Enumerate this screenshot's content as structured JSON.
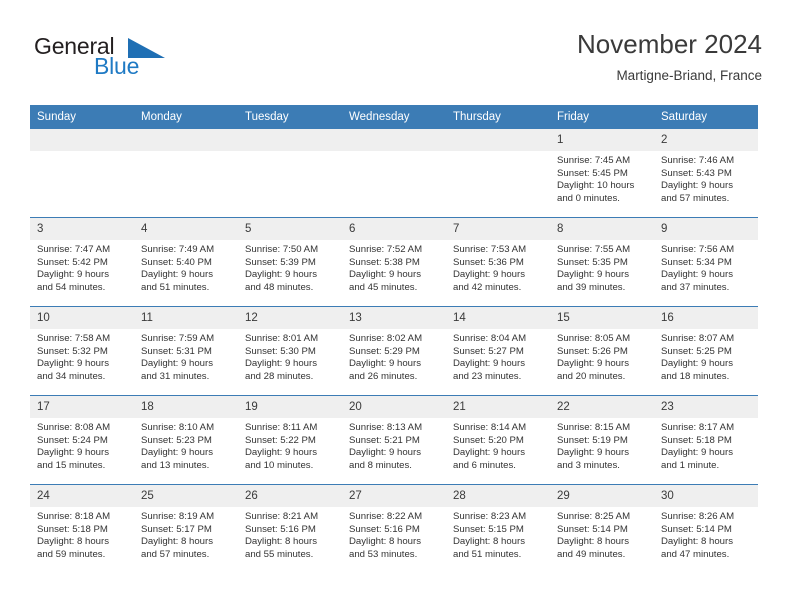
{
  "brand": {
    "name_part1": "General",
    "name_part2": "Blue",
    "logo_icon": "blue-triangle-flag-icon",
    "accent_color": "#1f7ac4"
  },
  "header": {
    "title": "November 2024",
    "location": "Martigne-Briand, France"
  },
  "theme": {
    "header_blue": "#3c7cb5",
    "daynum_band": "#efefef",
    "text": "#333333"
  },
  "calendar": {
    "weekday_headers": [
      "Sunday",
      "Monday",
      "Tuesday",
      "Wednesday",
      "Thursday",
      "Friday",
      "Saturday"
    ],
    "weeks": [
      [
        {
          "day": "",
          "blank": true,
          "info": ""
        },
        {
          "day": "",
          "blank": true,
          "info": ""
        },
        {
          "day": "",
          "blank": true,
          "info": ""
        },
        {
          "day": "",
          "blank": true,
          "info": ""
        },
        {
          "day": "",
          "blank": true,
          "info": ""
        },
        {
          "day": "1",
          "blank": false,
          "info": "Sunrise: 7:45 AM\nSunset: 5:45 PM\nDaylight: 10 hours\nand 0 minutes."
        },
        {
          "day": "2",
          "blank": false,
          "info": "Sunrise: 7:46 AM\nSunset: 5:43 PM\nDaylight: 9 hours\nand 57 minutes."
        }
      ],
      [
        {
          "day": "3",
          "blank": false,
          "info": "Sunrise: 7:47 AM\nSunset: 5:42 PM\nDaylight: 9 hours\nand 54 minutes."
        },
        {
          "day": "4",
          "blank": false,
          "info": "Sunrise: 7:49 AM\nSunset: 5:40 PM\nDaylight: 9 hours\nand 51 minutes."
        },
        {
          "day": "5",
          "blank": false,
          "info": "Sunrise: 7:50 AM\nSunset: 5:39 PM\nDaylight: 9 hours\nand 48 minutes."
        },
        {
          "day": "6",
          "blank": false,
          "info": "Sunrise: 7:52 AM\nSunset: 5:38 PM\nDaylight: 9 hours\nand 45 minutes."
        },
        {
          "day": "7",
          "blank": false,
          "info": "Sunrise: 7:53 AM\nSunset: 5:36 PM\nDaylight: 9 hours\nand 42 minutes."
        },
        {
          "day": "8",
          "blank": false,
          "info": "Sunrise: 7:55 AM\nSunset: 5:35 PM\nDaylight: 9 hours\nand 39 minutes."
        },
        {
          "day": "9",
          "blank": false,
          "info": "Sunrise: 7:56 AM\nSunset: 5:34 PM\nDaylight: 9 hours\nand 37 minutes."
        }
      ],
      [
        {
          "day": "10",
          "blank": false,
          "info": "Sunrise: 7:58 AM\nSunset: 5:32 PM\nDaylight: 9 hours\nand 34 minutes."
        },
        {
          "day": "11",
          "blank": false,
          "info": "Sunrise: 7:59 AM\nSunset: 5:31 PM\nDaylight: 9 hours\nand 31 minutes."
        },
        {
          "day": "12",
          "blank": false,
          "info": "Sunrise: 8:01 AM\nSunset: 5:30 PM\nDaylight: 9 hours\nand 28 minutes."
        },
        {
          "day": "13",
          "blank": false,
          "info": "Sunrise: 8:02 AM\nSunset: 5:29 PM\nDaylight: 9 hours\nand 26 minutes."
        },
        {
          "day": "14",
          "blank": false,
          "info": "Sunrise: 8:04 AM\nSunset: 5:27 PM\nDaylight: 9 hours\nand 23 minutes."
        },
        {
          "day": "15",
          "blank": false,
          "info": "Sunrise: 8:05 AM\nSunset: 5:26 PM\nDaylight: 9 hours\nand 20 minutes."
        },
        {
          "day": "16",
          "blank": false,
          "info": "Sunrise: 8:07 AM\nSunset: 5:25 PM\nDaylight: 9 hours\nand 18 minutes."
        }
      ],
      [
        {
          "day": "17",
          "blank": false,
          "info": "Sunrise: 8:08 AM\nSunset: 5:24 PM\nDaylight: 9 hours\nand 15 minutes."
        },
        {
          "day": "18",
          "blank": false,
          "info": "Sunrise: 8:10 AM\nSunset: 5:23 PM\nDaylight: 9 hours\nand 13 minutes."
        },
        {
          "day": "19",
          "blank": false,
          "info": "Sunrise: 8:11 AM\nSunset: 5:22 PM\nDaylight: 9 hours\nand 10 minutes."
        },
        {
          "day": "20",
          "blank": false,
          "info": "Sunrise: 8:13 AM\nSunset: 5:21 PM\nDaylight: 9 hours\nand 8 minutes."
        },
        {
          "day": "21",
          "blank": false,
          "info": "Sunrise: 8:14 AM\nSunset: 5:20 PM\nDaylight: 9 hours\nand 6 minutes."
        },
        {
          "day": "22",
          "blank": false,
          "info": "Sunrise: 8:15 AM\nSunset: 5:19 PM\nDaylight: 9 hours\nand 3 minutes."
        },
        {
          "day": "23",
          "blank": false,
          "info": "Sunrise: 8:17 AM\nSunset: 5:18 PM\nDaylight: 9 hours\nand 1 minute."
        }
      ],
      [
        {
          "day": "24",
          "blank": false,
          "info": "Sunrise: 8:18 AM\nSunset: 5:18 PM\nDaylight: 8 hours\nand 59 minutes."
        },
        {
          "day": "25",
          "blank": false,
          "info": "Sunrise: 8:19 AM\nSunset: 5:17 PM\nDaylight: 8 hours\nand 57 minutes."
        },
        {
          "day": "26",
          "blank": false,
          "info": "Sunrise: 8:21 AM\nSunset: 5:16 PM\nDaylight: 8 hours\nand 55 minutes."
        },
        {
          "day": "27",
          "blank": false,
          "info": "Sunrise: 8:22 AM\nSunset: 5:16 PM\nDaylight: 8 hours\nand 53 minutes."
        },
        {
          "day": "28",
          "blank": false,
          "info": "Sunrise: 8:23 AM\nSunset: 5:15 PM\nDaylight: 8 hours\nand 51 minutes."
        },
        {
          "day": "29",
          "blank": false,
          "info": "Sunrise: 8:25 AM\nSunset: 5:14 PM\nDaylight: 8 hours\nand 49 minutes."
        },
        {
          "day": "30",
          "blank": false,
          "info": "Sunrise: 8:26 AM\nSunset: 5:14 PM\nDaylight: 8 hours\nand 47 minutes."
        }
      ]
    ]
  }
}
